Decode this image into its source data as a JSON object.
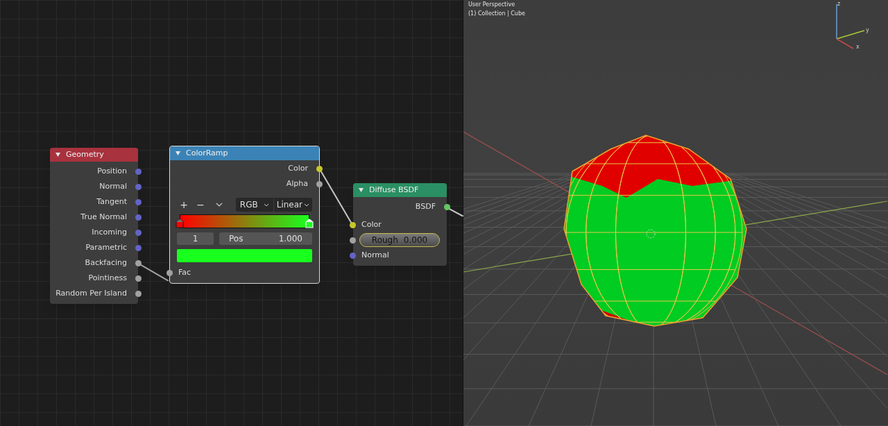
{
  "node_editor": {
    "nodes": [
      {
        "kind": "geometry",
        "title": "Geometry",
        "color": "#a8323e",
        "outputs": [
          {
            "label": "Position",
            "color": "#6363c7"
          },
          {
            "label": "Normal",
            "color": "#6363c7"
          },
          {
            "label": "Tangent",
            "color": "#6363c7"
          },
          {
            "label": "True Normal",
            "color": "#6363c7"
          },
          {
            "label": "Incoming",
            "color": "#6363c7"
          },
          {
            "label": "Parametric",
            "color": "#6363c7"
          },
          {
            "label": "Backfacing",
            "color": "#a1a1a1"
          },
          {
            "label": "Pointiness",
            "color": "#a1a1a1"
          },
          {
            "label": "Random Per Island",
            "color": "#a1a1a1"
          }
        ]
      },
      {
        "kind": "colorramp",
        "title": "ColorRamp",
        "color": "#3b83b6",
        "outputs": [
          {
            "label": "Color",
            "color": "#c7c729"
          },
          {
            "label": "Alpha",
            "color": "#a1a1a1"
          }
        ],
        "tools": [
          "+",
          "−"
        ],
        "color_mode": "RGB",
        "interpolation": "Linear",
        "stops": [
          {
            "color": "#ff0000",
            "selected": false
          },
          {
            "color": "#19ff1e",
            "selected": true
          }
        ],
        "stop_index": "1",
        "pos_label": "Pos",
        "pos_value": "1.000",
        "inputs": [
          {
            "label": "Fac",
            "color": "#a1a1a1"
          }
        ]
      },
      {
        "kind": "shader",
        "title": "Diffuse BSDF",
        "color": "#2a8f63",
        "outputs": [
          {
            "label": "BSDF",
            "color": "#63c763"
          }
        ],
        "inputs": [
          {
            "label": "Color",
            "color": "#c7c729"
          },
          {
            "label": "Rough",
            "value": "0.000",
            "color": "#a1a1a1"
          },
          {
            "label": "Normal",
            "color": "#6363c7"
          }
        ]
      }
    ]
  },
  "viewport": {
    "title": "User Perspective",
    "subtitle": "(1) Collection | Cube",
    "axes": [
      "z",
      "y",
      "x"
    ]
  }
}
